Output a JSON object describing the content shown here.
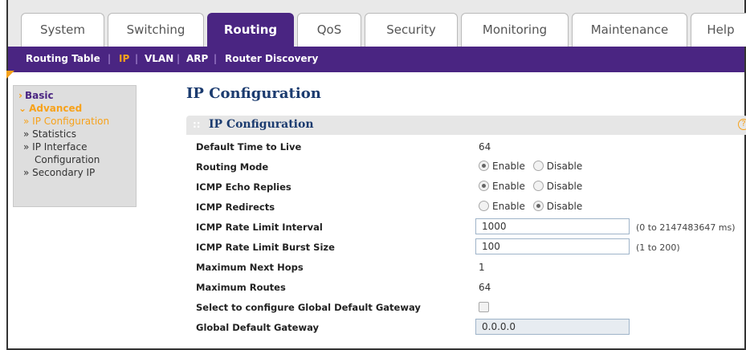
{
  "tabs": [
    "System",
    "Switching",
    "Routing",
    "QoS",
    "Security",
    "Monitoring",
    "Maintenance",
    "Help"
  ],
  "active_tab": "Routing",
  "submenu": [
    "Routing Table",
    "IP",
    "VLAN",
    "ARP",
    "Router Discovery"
  ],
  "active_submenu": "IP",
  "sidebar": {
    "basic": "Basic",
    "advanced": "Advanced",
    "items": [
      "» IP Configuration",
      "» Statistics",
      "» IP Interface",
      "Configuration",
      "» Secondary IP"
    ]
  },
  "page_title": "IP Configuration",
  "section": {
    "title": "IP Configuration",
    "grip": "::",
    "help": "?"
  },
  "fields": {
    "ttl": {
      "label": "Default Time to Live",
      "value": "64"
    },
    "routing_mode": {
      "label": "Routing Mode",
      "enable": "Enable",
      "disable": "Disable",
      "selected": "Enable"
    },
    "icmp_echo": {
      "label": "ICMP Echo Replies",
      "enable": "Enable",
      "disable": "Disable",
      "selected": "Enable"
    },
    "icmp_redirects": {
      "label": "ICMP Redirects",
      "enable": "Enable",
      "disable": "Disable",
      "selected": "Disable"
    },
    "rate_interval": {
      "label": "ICMP Rate Limit Interval",
      "value": "1000",
      "range": "(0 to 2147483647 ms)"
    },
    "rate_burst": {
      "label": "ICMP Rate Limit Burst Size",
      "value": "100",
      "range": "(1 to 200)"
    },
    "max_next_hops": {
      "label": "Maximum Next Hops",
      "value": "1"
    },
    "max_routes": {
      "label": "Maximum Routes",
      "value": "64"
    },
    "select_gateway": {
      "label": "Select to configure Global Default Gateway",
      "checked": false
    },
    "global_gateway": {
      "label": "Global Default Gateway",
      "value": "0.0.0.0"
    }
  },
  "colors": {
    "accent": "#4a2582",
    "highlight": "#f7a21b",
    "title": "#1b3b6f"
  }
}
